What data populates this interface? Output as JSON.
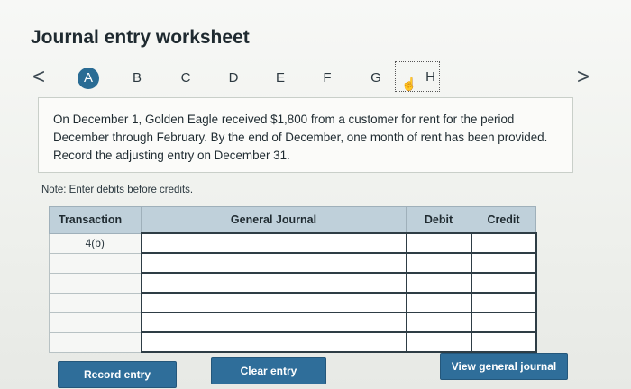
{
  "worksheet": {
    "title": "Journal entry worksheet"
  },
  "nav": {
    "prev_icon": "chevron-left-icon",
    "next_icon": "chevron-right-icon",
    "prev_glyph": "<",
    "next_glyph": ">",
    "steps": [
      "A",
      "B",
      "C",
      "D",
      "E",
      "F",
      "G",
      "H"
    ],
    "active_step": "A",
    "current_step": "H",
    "active_color": "#2a6c94"
  },
  "question": {
    "text": "On December 1, Golden Eagle received $1,800 from a customer for rent for the period December through February. By the end of December, one month of rent has been provided. Record the adjusting entry on December 31."
  },
  "note": {
    "text": "Note: Enter debits before credits."
  },
  "table": {
    "headers": {
      "transaction": "Transaction",
      "general_journal": "General Journal",
      "debit": "Debit",
      "credit": "Credit"
    },
    "rows": [
      {
        "transaction": "4(b)",
        "account": "",
        "debit": "",
        "credit": ""
      },
      {
        "transaction": "",
        "account": "",
        "debit": "",
        "credit": ""
      },
      {
        "transaction": "",
        "account": "",
        "debit": "",
        "credit": ""
      },
      {
        "transaction": "",
        "account": "",
        "debit": "",
        "credit": ""
      },
      {
        "transaction": "",
        "account": "",
        "debit": "",
        "credit": ""
      },
      {
        "transaction": "",
        "account": "",
        "debit": "",
        "credit": ""
      }
    ]
  },
  "buttons": {
    "record": "Record entry",
    "clear": "Clear entry",
    "view": "View general journal",
    "color": "#2f6e9a"
  }
}
